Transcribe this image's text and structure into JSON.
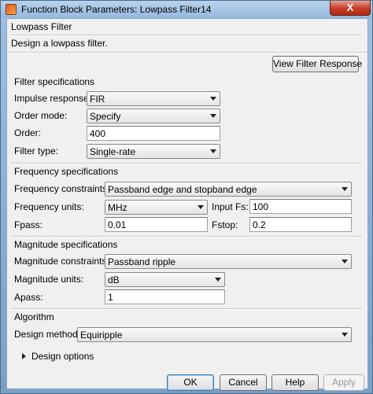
{
  "window": {
    "title": "Function Block Parameters: Lowpass Filter14",
    "close_label": "X"
  },
  "header": {
    "block_name": "Lowpass Filter",
    "description": "Design a lowpass filter."
  },
  "actions": {
    "view_filter_response": "View Filter Response"
  },
  "filter_specs": {
    "title": "Filter specifications",
    "impulse_response": {
      "label": "Impulse response:",
      "value": "FIR"
    },
    "order_mode": {
      "label": "Order mode:",
      "value": "Specify"
    },
    "order": {
      "label": "Order:",
      "value": "400"
    },
    "filter_type": {
      "label": "Filter type:",
      "value": "Single-rate"
    }
  },
  "frequency_specs": {
    "title": "Frequency specifications",
    "constraints": {
      "label": "Frequency constraints:",
      "value": "Passband edge and stopband edge"
    },
    "units": {
      "label": "Frequency units:",
      "value": "MHz"
    },
    "input_fs": {
      "label": "Input Fs:",
      "value": "100"
    },
    "fpass": {
      "label": "Fpass:",
      "value": "0.01"
    },
    "fstop": {
      "label": "Fstop:",
      "value": "0.2"
    }
  },
  "magnitude_specs": {
    "title": "Magnitude specifications",
    "constraints": {
      "label": "Magnitude constraints:",
      "value": "Passband ripple"
    },
    "units": {
      "label": "Magnitude units:",
      "value": "dB"
    },
    "apass": {
      "label": "Apass:",
      "value": "1"
    }
  },
  "algorithm": {
    "title": "Algorithm",
    "design_method": {
      "label": "Design method:",
      "value": "Equiripple"
    },
    "design_options": "Design options"
  },
  "footer": {
    "ok": "OK",
    "cancel": "Cancel",
    "help": "Help",
    "apply": "Apply"
  }
}
